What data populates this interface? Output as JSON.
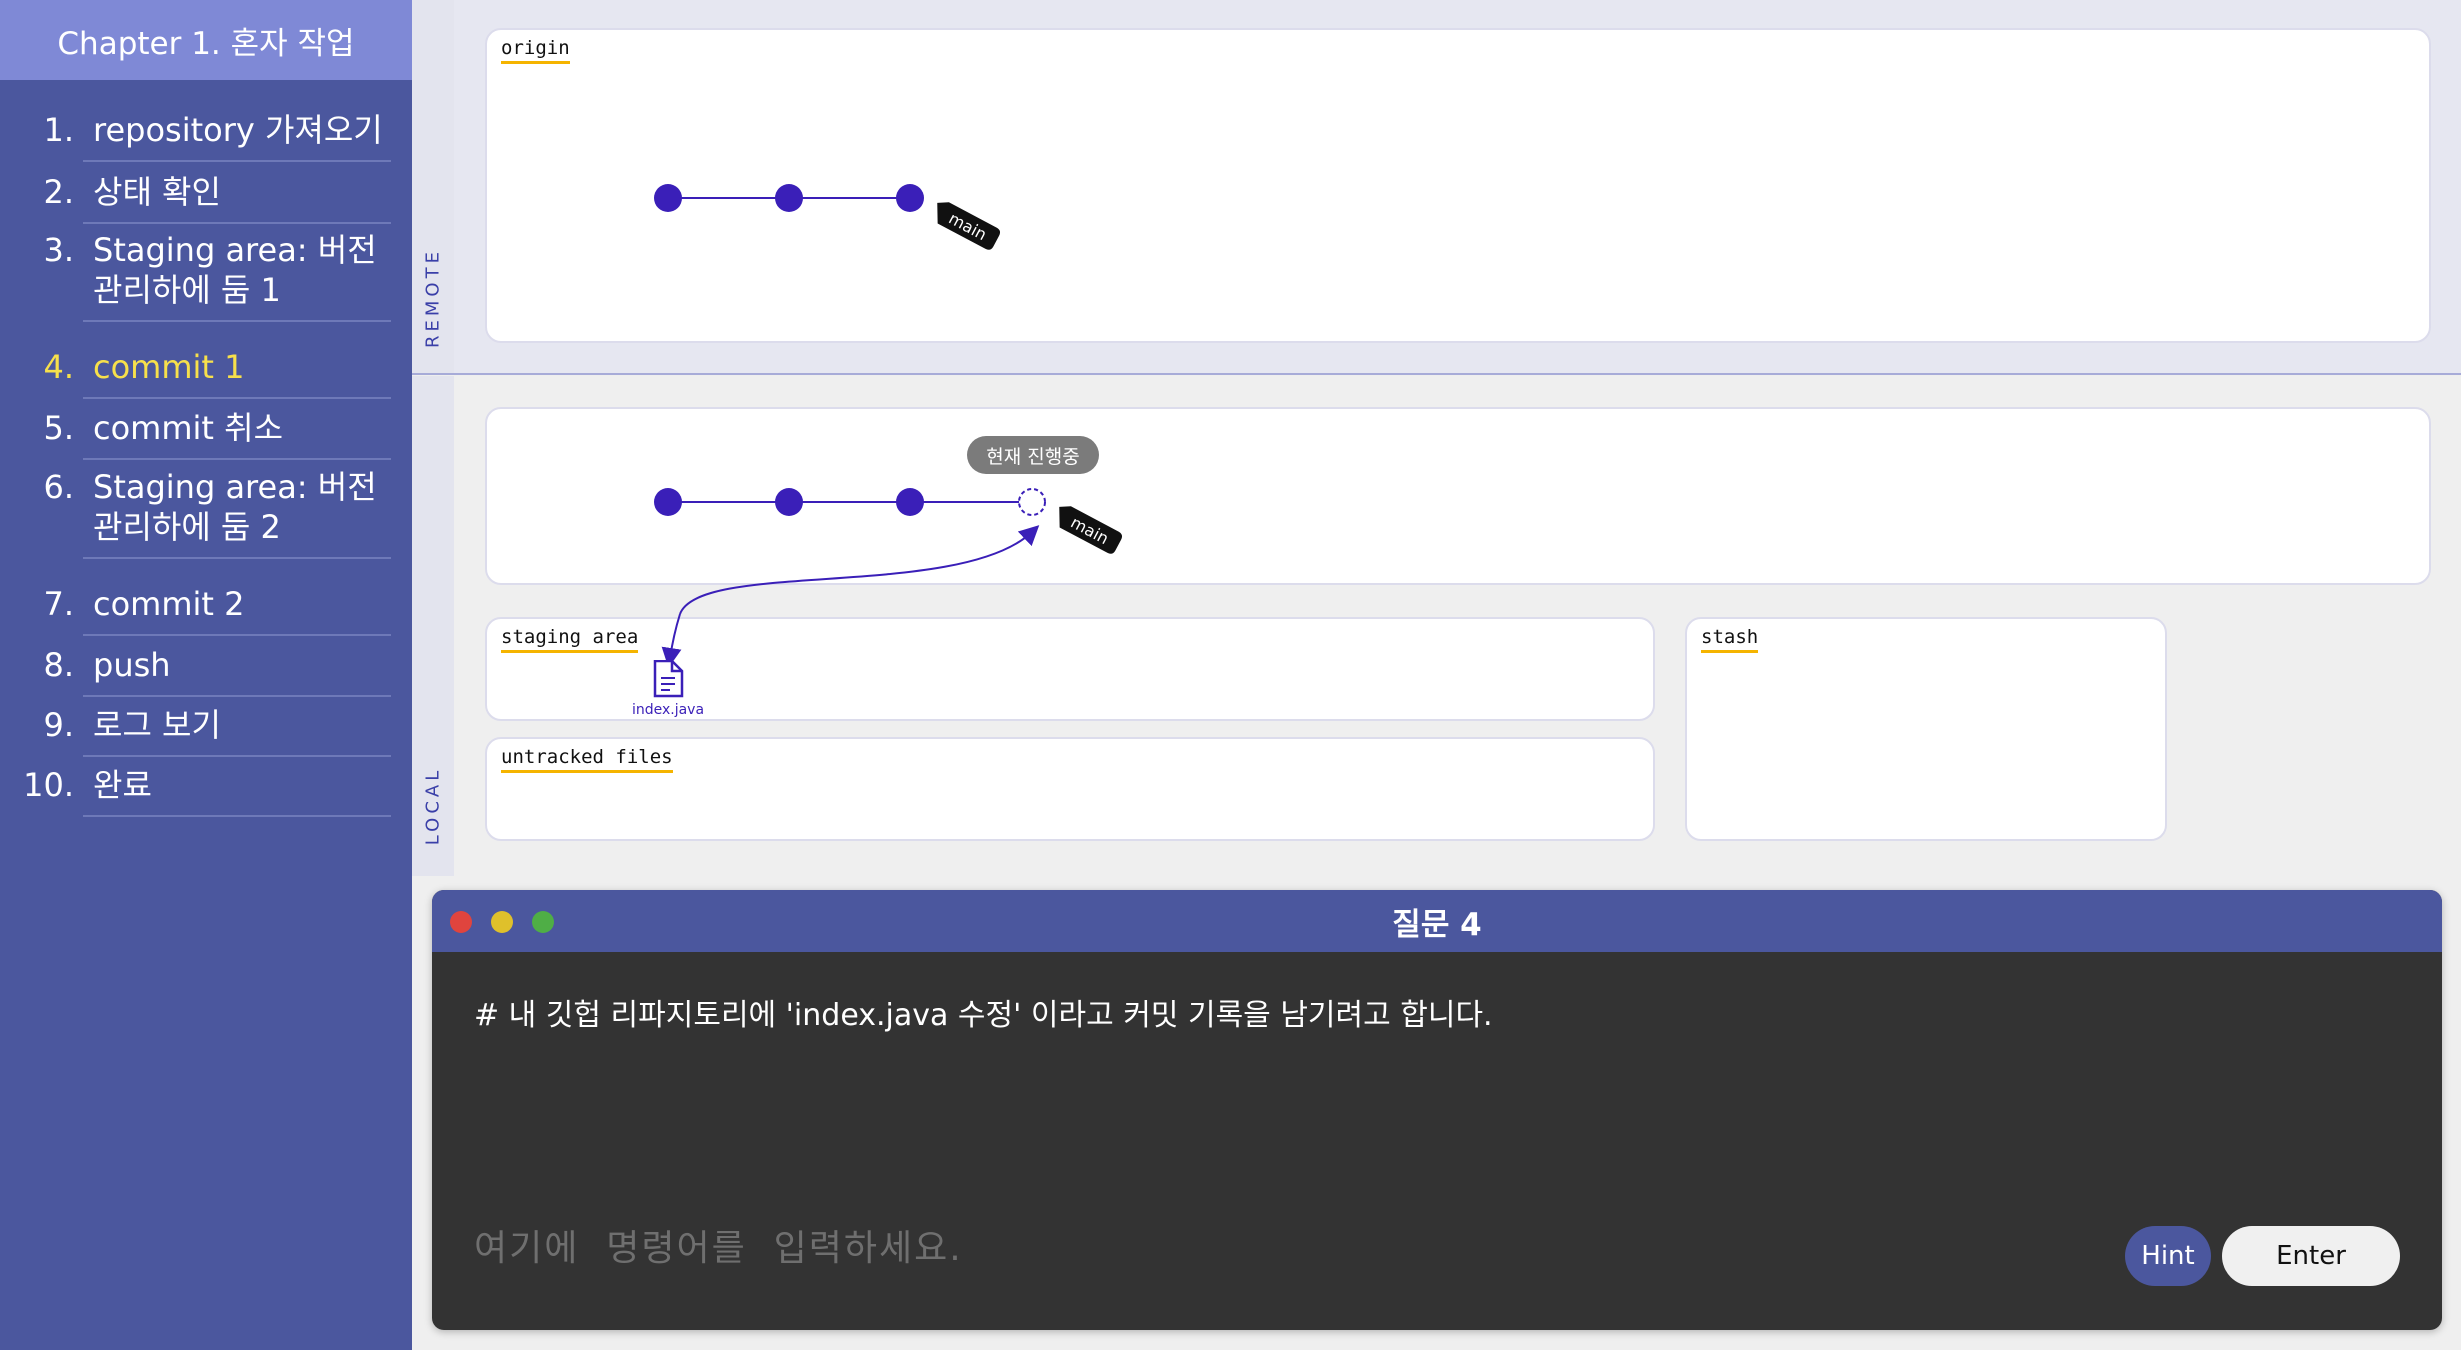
{
  "sidebar": {
    "chapter_title": "Chapter 1. 혼자 작업",
    "items": [
      {
        "num": "1.",
        "label": "repository 가져오기",
        "active": false
      },
      {
        "num": "2.",
        "label": "상태 확인",
        "active": false
      },
      {
        "num": "3.",
        "label": "Staging area: 버전 관리하에 둠 1",
        "active": false
      },
      {
        "num": "4.",
        "label": "commit 1",
        "active": true
      },
      {
        "num": "5.",
        "label": "commit 취소",
        "active": false
      },
      {
        "num": "6.",
        "label": "Staging area: 버전 관리하에 둠 2",
        "active": false
      },
      {
        "num": "7.",
        "label": "commit 2",
        "active": false
      },
      {
        "num": "8.",
        "label": "push",
        "active": false
      },
      {
        "num": "9.",
        "label": "로그 보기",
        "active": false
      },
      {
        "num": "10.",
        "label": "완료",
        "active": false
      }
    ]
  },
  "remote": {
    "section_label": "REMOTE",
    "panel_title": "origin",
    "commits": 3,
    "branch": "main"
  },
  "local": {
    "section_label": "LOCAL",
    "commits": 3,
    "pending_commit": true,
    "branch": "main",
    "in_progress_label": "현재 진행중",
    "staging_title": "staging area",
    "staged_files": [
      "index.java"
    ],
    "untracked_title": "untracked files",
    "stash_title": "stash"
  },
  "question": {
    "title": "질문 4",
    "text": "# 내 깃헙 리파지토리에 'index.java 수정' 이라고 커밋 기록을 남기려고 합니다.",
    "input_placeholder": "여기에  명령어를  입력하세요.",
    "input_value": "",
    "hint_label": "Hint",
    "enter_label": "Enter"
  },
  "colors": {
    "sidebar_bg": "#4b579e",
    "sidebar_header_bg": "#7f89d6",
    "active_item": "#f7e04b",
    "commit_node": "#3a1fb8",
    "highlight_underline": "#f5b400",
    "terminal_bg": "#333333",
    "close_dot": "#e0443e",
    "minimize_dot": "#dfc02b",
    "maximize_dot": "#4fae46"
  }
}
